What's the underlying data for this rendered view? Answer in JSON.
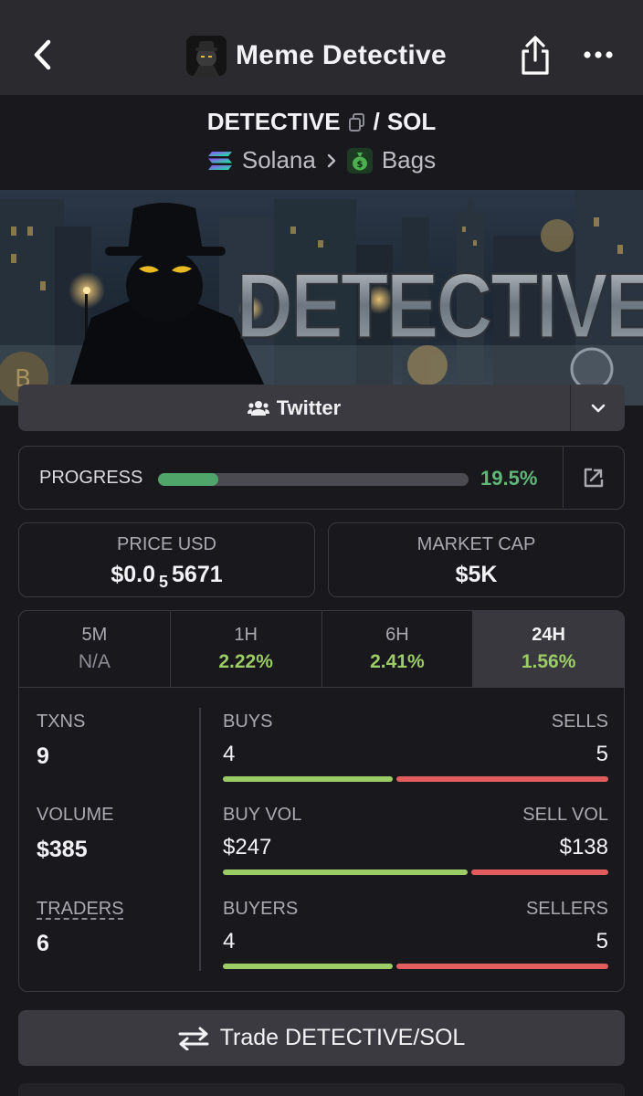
{
  "header": {
    "title": "Meme Detective",
    "back_icon": "chevron-left-icon",
    "share_icon": "share-icon",
    "more_icon": "more-horizontal-icon"
  },
  "pair": {
    "base": "DETECTIVE",
    "separator": "/",
    "quote": "SOL",
    "chain": "Solana",
    "dex": "Bags"
  },
  "banner": {
    "wordmark": "DETECTIVE"
  },
  "social": {
    "twitter_label": "Twitter"
  },
  "progress": {
    "label": "PROGRESS",
    "value_text": "19.5%",
    "value": 0.195
  },
  "price": {
    "label": "PRICE USD",
    "prefix": "$0.0",
    "zeros": "5",
    "suffix": "5671"
  },
  "market_cap": {
    "label": "MARKET CAP",
    "value": "$5K"
  },
  "tabs": [
    {
      "label": "5M",
      "value": "N/A"
    },
    {
      "label": "1H",
      "value": "2.22%"
    },
    {
      "label": "6H",
      "value": "2.41%"
    },
    {
      "label": "24H",
      "value": "1.56%"
    }
  ],
  "stats": {
    "txns": {
      "label": "TXNS",
      "value": "9"
    },
    "volume": {
      "label": "VOLUME",
      "value": "$385"
    },
    "traders": {
      "label": "TRADERS",
      "value": "6"
    },
    "buys": {
      "label": "BUYS",
      "value": "4",
      "sell_label": "SELLS",
      "sell_value": "5",
      "buy_share": 0.444
    },
    "vol": {
      "label": "BUY VOL",
      "value": "$247",
      "sell_label": "SELL VOL",
      "sell_value": "$138",
      "buy_share": 0.642
    },
    "buyers": {
      "label": "BUYERS",
      "value": "4",
      "sell_label": "SELLERS",
      "sell_value": "5",
      "buy_share": 0.444
    }
  },
  "trade": {
    "label": "Trade DETECTIVE/SOL"
  },
  "colors": {
    "accent_green": "#9ccc65",
    "accent_red": "#e25d5d",
    "progress_green": "#4fa56a",
    "surface": "#3a3a40"
  }
}
